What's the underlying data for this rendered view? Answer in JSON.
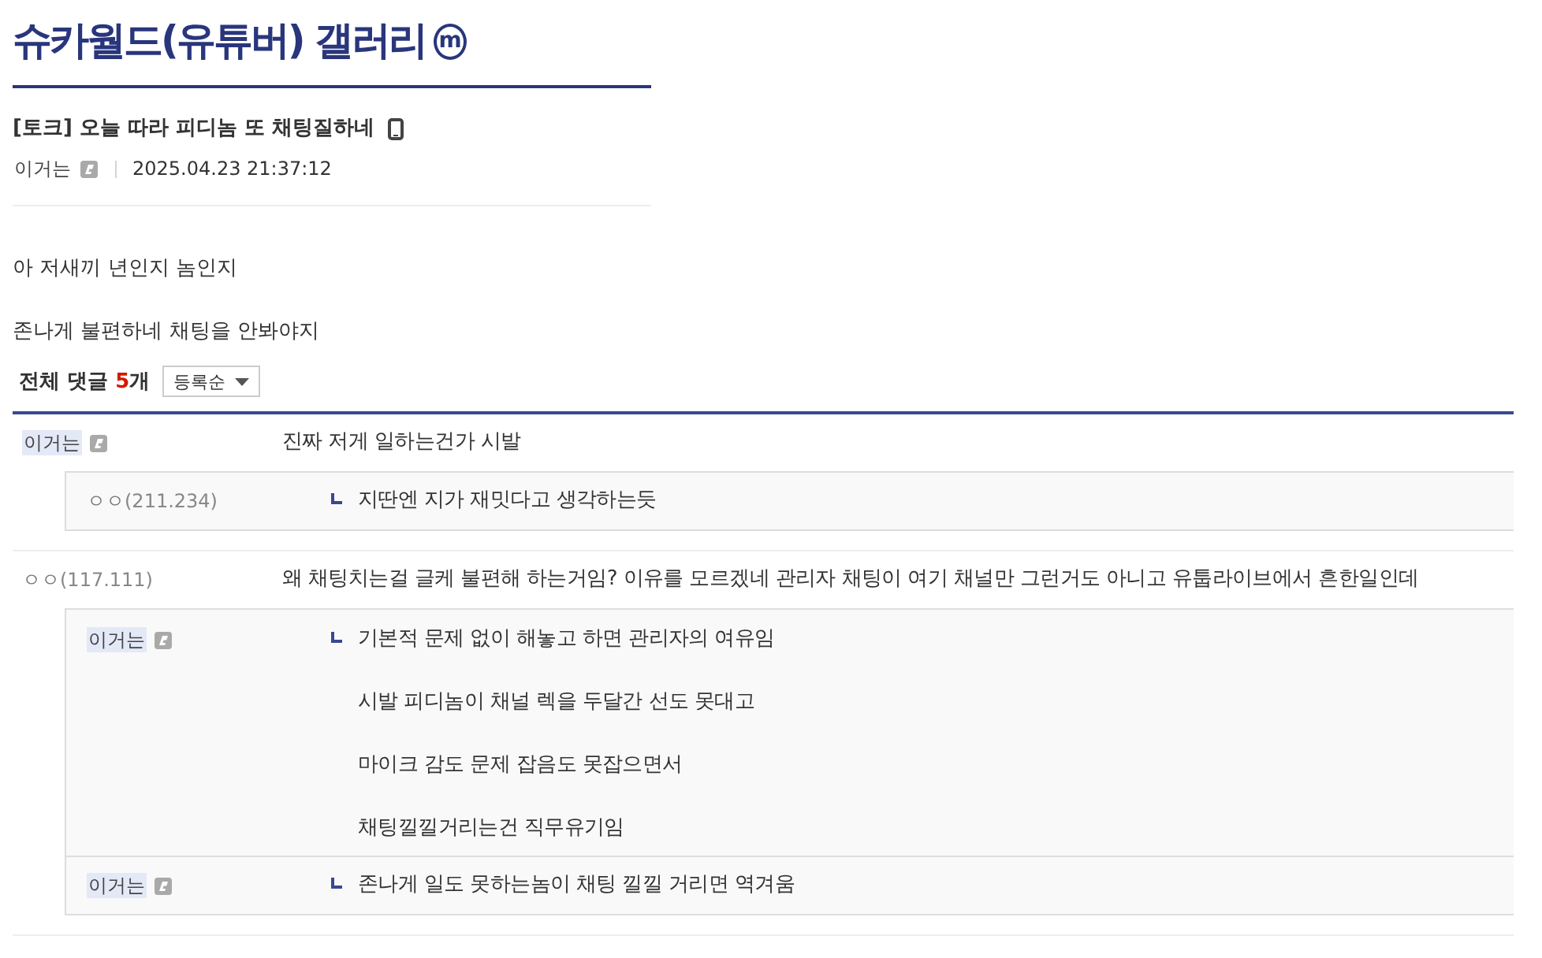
{
  "gallery": {
    "title": "슈카월드(유튜버) 갤러리",
    "badge": "m"
  },
  "post": {
    "title": "[토크] 오늘 따라 피디놈 또 채팅질하네",
    "mobile": true,
    "author": {
      "name": "이거는",
      "kind": "member"
    },
    "date": "2025.04.23 21:37:12",
    "body": [
      "아 저새끼 년인지 놈인지",
      "존나게 불편하네 채팅을 안봐야지"
    ]
  },
  "comments_header": {
    "label": "전체 댓글",
    "count": "5",
    "unit": "개",
    "sort": "등록순"
  },
  "comments": [
    {
      "author": {
        "name": "이거는",
        "kind": "member",
        "op": true
      },
      "lines": [
        "진짜 저게 일하는건가 시발"
      ],
      "replies": [
        {
          "author": {
            "name": "ㅇㅇ",
            "ip": "(211.234)",
            "kind": "guest",
            "op": false
          },
          "lines": [
            "지딴엔 지가 재밋다고 생각하는듯"
          ]
        }
      ]
    },
    {
      "author": {
        "name": "ㅇㅇ",
        "ip": "(117.111)",
        "kind": "guest",
        "op": false
      },
      "lines": [
        "왜 채팅치는걸 글케 불편해 하는거임? 이유를 모르겠네 관리자 채팅이 여기 채널만 그런거도 아니고 유툽라이브에서 흔한일인데"
      ],
      "replies": [
        {
          "author": {
            "name": "이거는",
            "kind": "member",
            "op": true
          },
          "lines": [
            "기본적 문제 없이 해놓고 하면 관리자의 여유임",
            "시발 피디놈이 채널 렉을 두달간 선도 못대고",
            "마이크 감도 문제 잡음도 못잡으면서",
            "채팅낄낄거리는건 직무유기임"
          ]
        },
        {
          "author": {
            "name": "이거는",
            "kind": "member",
            "op": true
          },
          "lines": [
            "존나게 일도 못하는놈이 채팅 낄낄 거리면 역겨움"
          ]
        }
      ]
    }
  ]
}
